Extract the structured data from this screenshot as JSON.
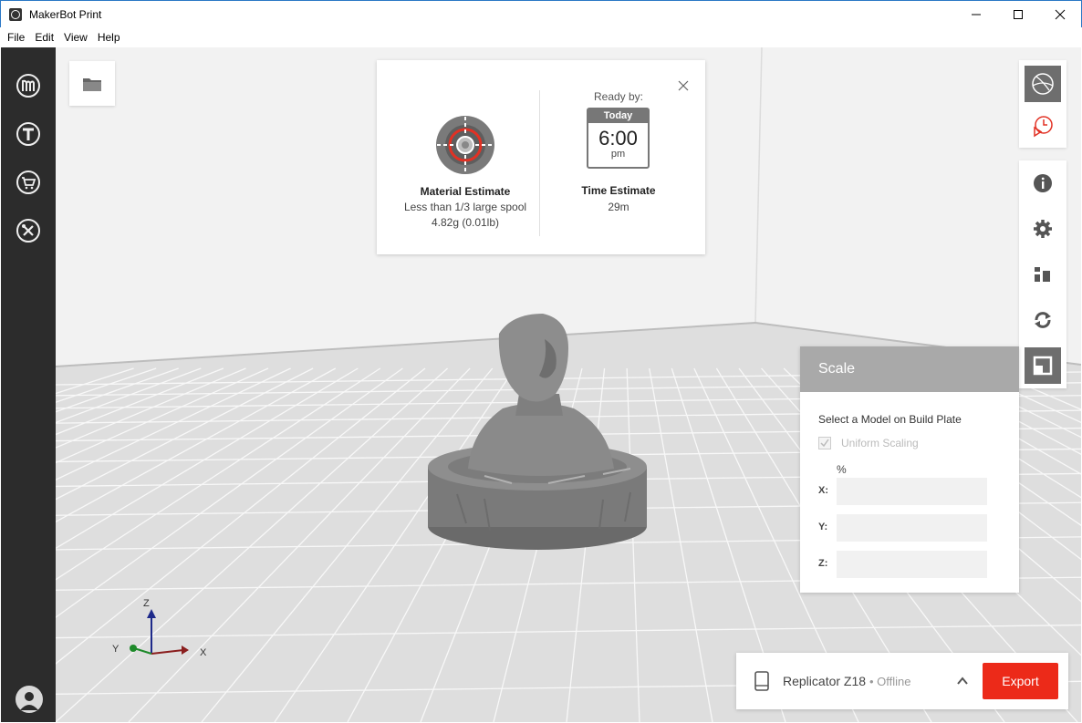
{
  "window": {
    "title": "MakerBot Print",
    "controls": [
      "minimize-icon",
      "maximize-icon",
      "close-icon"
    ]
  },
  "menu": {
    "items": [
      "File",
      "Edit",
      "View",
      "Help"
    ]
  },
  "sidebar": {
    "items": [
      {
        "name": "makerbot-logo-icon"
      },
      {
        "name": "thingiverse-icon"
      },
      {
        "name": "store-cart-icon"
      },
      {
        "name": "tools-icon"
      }
    ],
    "account_icon": "avatar-icon"
  },
  "viewport": {
    "open_file_icon": "folder-icon",
    "axes": {
      "z": "Z",
      "y": "Y",
      "x": "X"
    }
  },
  "estimate": {
    "material_title": "Material Estimate",
    "material_line1": "Less than 1/3 large spool",
    "material_line2": "4.82g (0.01lb)",
    "ready_label": "Ready by:",
    "calendar_day": "Today",
    "calendar_time": "6:00",
    "calendar_ampm": "pm",
    "time_title": "Time Estimate",
    "time_value": "29m"
  },
  "right_toolbar": {
    "view_group": [
      "view-mode-icon",
      "print-preview-icon"
    ],
    "tools_group": [
      "info-icon",
      "settings-icon",
      "arrange-icon",
      "rotate-icon",
      "scale-icon"
    ],
    "active_tool": "scale-icon"
  },
  "scale_panel": {
    "title": "Scale",
    "hint": "Select a Model on Build Plate",
    "uniform_label": "Uniform Scaling",
    "uniform_checked": true,
    "unit": "%",
    "x_label": "X:",
    "y_label": "Y:",
    "z_label": "Z:",
    "x_value": "",
    "y_value": "",
    "z_value": ""
  },
  "printer": {
    "name": "Replicator Z18",
    "status": "• Offline",
    "export_label": "Export"
  },
  "colors": {
    "sidebar_bg": "#2c2c2c",
    "export_red": "#ec2a19",
    "panel_header": "#a9a9a9",
    "accent_red": "#e23124"
  }
}
